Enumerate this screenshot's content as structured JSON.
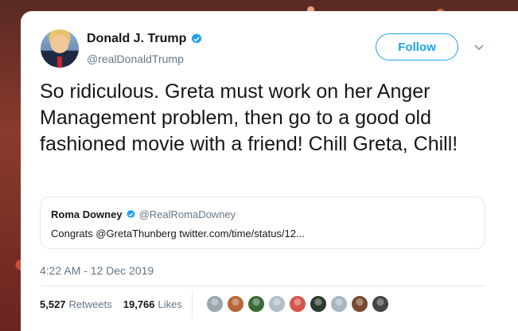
{
  "tweet": {
    "author_name": "Donald J. Trump",
    "author_handle": "@realDonaldTrump",
    "follow_label": "Follow",
    "text": "So ridiculous. Greta must work on her Anger Management problem, then go to a good old fashioned movie with a friend! Chill Greta, Chill!",
    "timestamp": "4:22 AM - 12 Dec 2019",
    "quoted": {
      "name": "Roma Downey",
      "handle": "@RealRomaDowney",
      "text": "Congrats @GretaThunberg twitter.com/time/status/12..."
    },
    "stats": {
      "retweets_count": "5,527",
      "retweets_label": "Retweets",
      "likes_count": "19,766",
      "likes_label": "Likes"
    },
    "liker_avatars": [
      "#9aa7b0",
      "#b5673a",
      "#3b6b3a",
      "#b3bec6",
      "#d3554a",
      "#2d3a2e",
      "#aab6bf",
      "#7a4a30",
      "#444444"
    ]
  },
  "colors": {
    "accent": "#1da1f2",
    "text": "#14171a",
    "secondary": "#657786"
  },
  "icons": {
    "verified": "verified-badge-icon",
    "caret": "chevron-down-icon"
  }
}
